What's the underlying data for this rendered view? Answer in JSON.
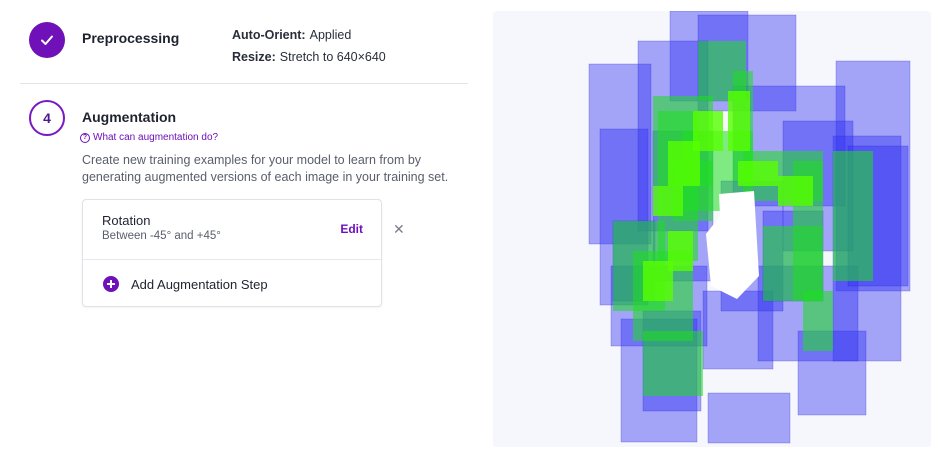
{
  "preprocessing": {
    "title": "Preprocessing",
    "auto_orient_label": "Auto-Orient:",
    "auto_orient_value": "Applied",
    "resize_label": "Resize:",
    "resize_value": "Stretch to 640×640"
  },
  "augmentation": {
    "step_number": "4",
    "title": "Augmentation",
    "help_link": "What can augmentation do?",
    "description": "Create new training examples for your model to learn from by generating augmented versions of each image in your training set.",
    "steps": [
      {
        "name": "Rotation",
        "detail": "Between -45° and +45°",
        "edit_label": "Edit"
      }
    ],
    "add_step_label": "Add Augmentation Step"
  },
  "colors": {
    "accent": "#6f10b8",
    "box_fill": "#2f2ff2",
    "hot_fill": "#33ff00"
  },
  "icons": {
    "done": "check-icon",
    "help": "question-circle-icon",
    "add": "plus-circle-icon",
    "remove": "close-icon"
  }
}
